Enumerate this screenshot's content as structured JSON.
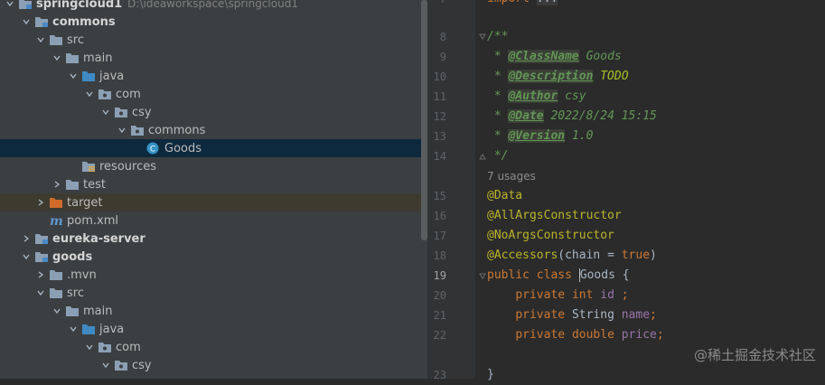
{
  "tree": {
    "root": {
      "name": "springcloud1",
      "path": "D:\\ideaworkspace\\springcloud1"
    },
    "items": [
      {
        "label": "commons"
      },
      {
        "label": "src"
      },
      {
        "label": "main"
      },
      {
        "label": "java"
      },
      {
        "label": "com"
      },
      {
        "label": "csy"
      },
      {
        "label": "commons"
      },
      {
        "label": "Goods"
      },
      {
        "label": "resources"
      },
      {
        "label": "test"
      },
      {
        "label": "target"
      },
      {
        "label": "pom.xml"
      },
      {
        "label": "eureka-server"
      },
      {
        "label": "goods"
      },
      {
        "label": ".mvn"
      },
      {
        "label": "src"
      },
      {
        "label": "main"
      },
      {
        "label": "java"
      },
      {
        "label": "com"
      },
      {
        "label": "csy"
      }
    ]
  },
  "editor": {
    "line_numbers": [
      "8",
      "9",
      "10",
      "11",
      "12",
      "13",
      "14",
      "15",
      "16",
      "17",
      "18",
      "19",
      "20",
      "21",
      "22",
      "23"
    ],
    "usages_hint": "7 usages",
    "code": {
      "import_kw": "import",
      "import_rest": "...",
      "doc_open": "/**",
      "star": "*",
      "doc_close": "*/",
      "tag_classname": "@ClassName",
      "val_classname": "Goods",
      "tag_description": "@Description",
      "val_description": "TODO",
      "tag_author": "@Author",
      "val_author": "csy",
      "tag_date": "@Date",
      "val_date": "2022/8/24 15:15",
      "tag_version": "@Version",
      "val_version": "1.0",
      "ann_data": "@Data",
      "ann_allargs": "@AllArgsConstructor",
      "ann_noargs": "@NoArgsConstructor",
      "ann_accessors": "@Accessors",
      "accessors_open": "(chain = ",
      "accessors_true": "true",
      "accessors_close": ")",
      "kw_public": "public",
      "kw_class": "class",
      "class_name": "Goods",
      "brace_open": "{",
      "kw_private": "private",
      "kw_int": "int",
      "field_id": "id",
      "semi_spaced": " ;",
      "type_string": "String",
      "field_name": "name",
      "semi": ";",
      "kw_double": "double",
      "field_price": "price",
      "brace_close": "}"
    }
  },
  "watermark": "@稀土掘金技术社区",
  "colors": {
    "tree_bg": "#3c3f41",
    "editor_bg": "#2b2b2b",
    "selection": "#0d293e",
    "excluded": "#3d3b30",
    "comment": "#629755",
    "keyword": "#cc7832",
    "annotation": "#bbb529",
    "field": "#9876aa"
  }
}
